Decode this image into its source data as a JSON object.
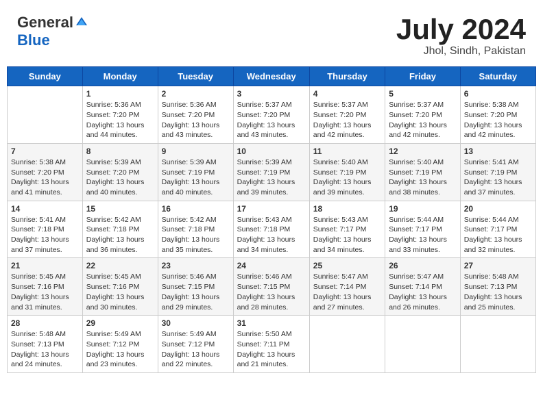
{
  "header": {
    "logo_general": "General",
    "logo_blue": "Blue",
    "title": "July 2024",
    "location": "Jhol, Sindh, Pakistan"
  },
  "weekdays": [
    "Sunday",
    "Monday",
    "Tuesday",
    "Wednesday",
    "Thursday",
    "Friday",
    "Saturday"
  ],
  "weeks": [
    [
      {
        "day": "",
        "info": ""
      },
      {
        "day": "1",
        "info": "Sunrise: 5:36 AM\nSunset: 7:20 PM\nDaylight: 13 hours and 44 minutes."
      },
      {
        "day": "2",
        "info": "Sunrise: 5:36 AM\nSunset: 7:20 PM\nDaylight: 13 hours and 43 minutes."
      },
      {
        "day": "3",
        "info": "Sunrise: 5:37 AM\nSunset: 7:20 PM\nDaylight: 13 hours and 43 minutes."
      },
      {
        "day": "4",
        "info": "Sunrise: 5:37 AM\nSunset: 7:20 PM\nDaylight: 13 hours and 42 minutes."
      },
      {
        "day": "5",
        "info": "Sunrise: 5:37 AM\nSunset: 7:20 PM\nDaylight: 13 hours and 42 minutes."
      },
      {
        "day": "6",
        "info": "Sunrise: 5:38 AM\nSunset: 7:20 PM\nDaylight: 13 hours and 42 minutes."
      }
    ],
    [
      {
        "day": "7",
        "info": "Sunrise: 5:38 AM\nSunset: 7:20 PM\nDaylight: 13 hours and 41 minutes."
      },
      {
        "day": "8",
        "info": "Sunrise: 5:39 AM\nSunset: 7:20 PM\nDaylight: 13 hours and 40 minutes."
      },
      {
        "day": "9",
        "info": "Sunrise: 5:39 AM\nSunset: 7:19 PM\nDaylight: 13 hours and 40 minutes."
      },
      {
        "day": "10",
        "info": "Sunrise: 5:39 AM\nSunset: 7:19 PM\nDaylight: 13 hours and 39 minutes."
      },
      {
        "day": "11",
        "info": "Sunrise: 5:40 AM\nSunset: 7:19 PM\nDaylight: 13 hours and 39 minutes."
      },
      {
        "day": "12",
        "info": "Sunrise: 5:40 AM\nSunset: 7:19 PM\nDaylight: 13 hours and 38 minutes."
      },
      {
        "day": "13",
        "info": "Sunrise: 5:41 AM\nSunset: 7:19 PM\nDaylight: 13 hours and 37 minutes."
      }
    ],
    [
      {
        "day": "14",
        "info": "Sunrise: 5:41 AM\nSunset: 7:18 PM\nDaylight: 13 hours and 37 minutes."
      },
      {
        "day": "15",
        "info": "Sunrise: 5:42 AM\nSunset: 7:18 PM\nDaylight: 13 hours and 36 minutes."
      },
      {
        "day": "16",
        "info": "Sunrise: 5:42 AM\nSunset: 7:18 PM\nDaylight: 13 hours and 35 minutes."
      },
      {
        "day": "17",
        "info": "Sunrise: 5:43 AM\nSunset: 7:18 PM\nDaylight: 13 hours and 34 minutes."
      },
      {
        "day": "18",
        "info": "Sunrise: 5:43 AM\nSunset: 7:17 PM\nDaylight: 13 hours and 34 minutes."
      },
      {
        "day": "19",
        "info": "Sunrise: 5:44 AM\nSunset: 7:17 PM\nDaylight: 13 hours and 33 minutes."
      },
      {
        "day": "20",
        "info": "Sunrise: 5:44 AM\nSunset: 7:17 PM\nDaylight: 13 hours and 32 minutes."
      }
    ],
    [
      {
        "day": "21",
        "info": "Sunrise: 5:45 AM\nSunset: 7:16 PM\nDaylight: 13 hours and 31 minutes."
      },
      {
        "day": "22",
        "info": "Sunrise: 5:45 AM\nSunset: 7:16 PM\nDaylight: 13 hours and 30 minutes."
      },
      {
        "day": "23",
        "info": "Sunrise: 5:46 AM\nSunset: 7:15 PM\nDaylight: 13 hours and 29 minutes."
      },
      {
        "day": "24",
        "info": "Sunrise: 5:46 AM\nSunset: 7:15 PM\nDaylight: 13 hours and 28 minutes."
      },
      {
        "day": "25",
        "info": "Sunrise: 5:47 AM\nSunset: 7:14 PM\nDaylight: 13 hours and 27 minutes."
      },
      {
        "day": "26",
        "info": "Sunrise: 5:47 AM\nSunset: 7:14 PM\nDaylight: 13 hours and 26 minutes."
      },
      {
        "day": "27",
        "info": "Sunrise: 5:48 AM\nSunset: 7:13 PM\nDaylight: 13 hours and 25 minutes."
      }
    ],
    [
      {
        "day": "28",
        "info": "Sunrise: 5:48 AM\nSunset: 7:13 PM\nDaylight: 13 hours and 24 minutes."
      },
      {
        "day": "29",
        "info": "Sunrise: 5:49 AM\nSunset: 7:12 PM\nDaylight: 13 hours and 23 minutes."
      },
      {
        "day": "30",
        "info": "Sunrise: 5:49 AM\nSunset: 7:12 PM\nDaylight: 13 hours and 22 minutes."
      },
      {
        "day": "31",
        "info": "Sunrise: 5:50 AM\nSunset: 7:11 PM\nDaylight: 13 hours and 21 minutes."
      },
      {
        "day": "",
        "info": ""
      },
      {
        "day": "",
        "info": ""
      },
      {
        "day": "",
        "info": ""
      }
    ]
  ]
}
